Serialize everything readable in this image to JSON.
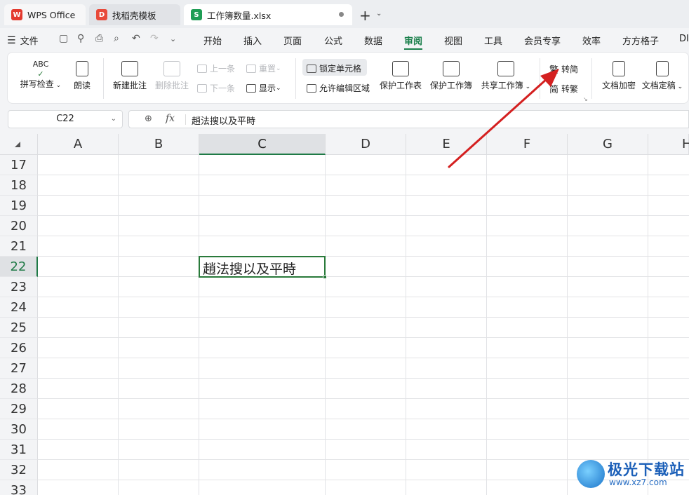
{
  "tabs": [
    {
      "label": "WPS Office",
      "logo": "W"
    },
    {
      "label": "找稻壳模板",
      "logo": "D"
    },
    {
      "label": "工作簿数量.xlsx",
      "logo": "S"
    }
  ],
  "menu": {
    "file": "文件",
    "items": [
      "开始",
      "插入",
      "页面",
      "公式",
      "数据",
      "审阅",
      "视图",
      "工具",
      "会员专享",
      "效率",
      "方方格子",
      "DI"
    ],
    "active": "审阅"
  },
  "ribbon": {
    "spellcheck": "拼写检查",
    "read_aloud": "朗读",
    "new_comment": "新建批注",
    "delete_comment": "删除批注",
    "prev": "上一条",
    "next": "下一条",
    "reset": "重置",
    "show": "显示",
    "lock_cell": "锁定单元格",
    "allow_edit": "允许编辑区域",
    "protect_sheet": "保护工作表",
    "protect_book": "保护工作簿",
    "share_book": "共享工作簿",
    "to_simplified": "转简",
    "to_traditional": "转繁",
    "fan_char": "繁",
    "jian_char": "简",
    "encrypt": "文档加密",
    "finalize": "文档定稿",
    "abc": "ABC"
  },
  "formula_bar": {
    "cell_ref": "C22",
    "fx": "fx",
    "value": "趙法搜以及平時"
  },
  "grid": {
    "columns": [
      "A",
      "B",
      "C",
      "D",
      "E",
      "F",
      "G",
      "H"
    ],
    "selected_column": "C",
    "rows": [
      "17",
      "18",
      "19",
      "20",
      "21",
      "22",
      "23",
      "24",
      "25",
      "26",
      "27",
      "28",
      "29",
      "30",
      "31",
      "32",
      "33"
    ],
    "selected_row": "22",
    "active_cell_text": "趙法搜以及平時"
  },
  "watermark": {
    "title": "极光下载站",
    "url": "www.xz7.com"
  },
  "colors": {
    "accent": "#1a7f4b",
    "arrow": "#d42020"
  }
}
